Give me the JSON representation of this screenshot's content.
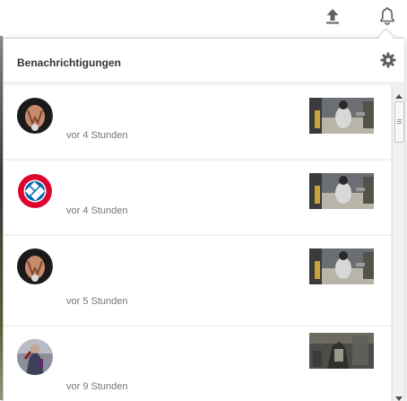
{
  "header": {
    "title": "Benachrichtigungen",
    "settings_icon": "gear-icon"
  },
  "topbar": {
    "icons": [
      "upload-icon",
      "bell-icon"
    ]
  },
  "notifications": [
    {
      "avatar": "hands-avatar",
      "time": "vor 4 Stunden",
      "thumbnail": "video-thumbnail"
    },
    {
      "avatar": "fc-bayern-logo",
      "time": "vor 4 Stunden",
      "thumbnail": "video-thumbnail"
    },
    {
      "avatar": "hands-avatar",
      "time": "vor 5 Stunden",
      "thumbnail": "video-thumbnail"
    },
    {
      "avatar": "person-avatar",
      "time": "vor 9 Stunden",
      "thumbnail": "video-thumbnail"
    }
  ],
  "colors": {
    "panel_background": "#f1f1f1",
    "item_background": "#ffffff",
    "time_text": "#767676",
    "title_text": "#333333",
    "icon": "#606060"
  }
}
